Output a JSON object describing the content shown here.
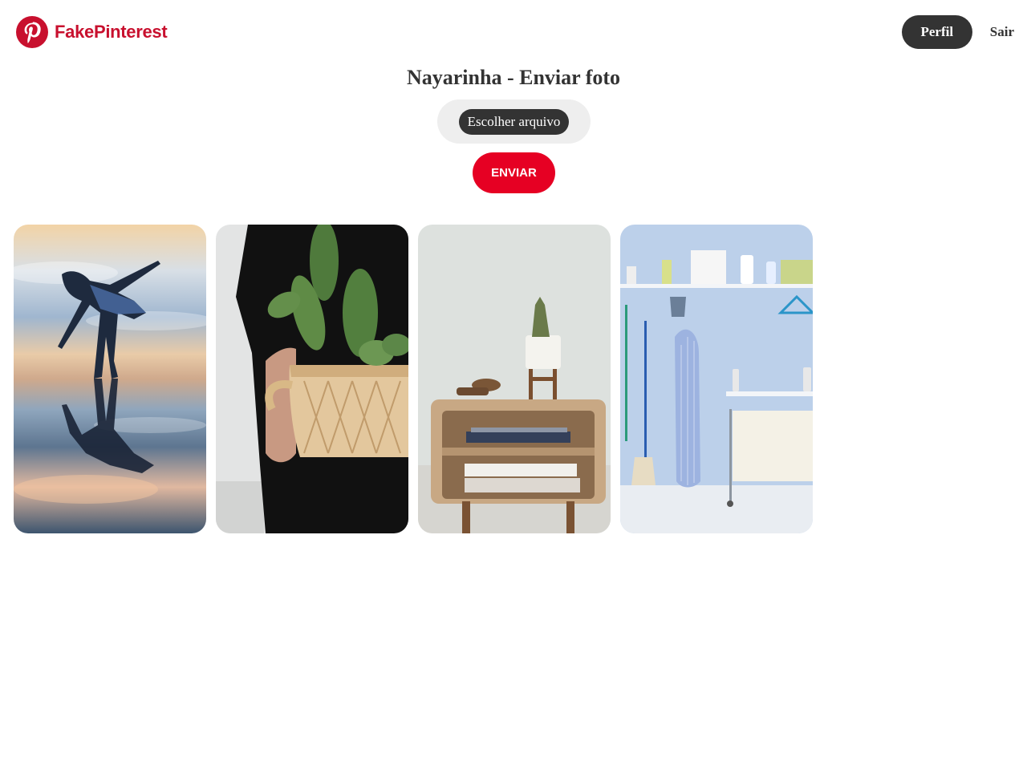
{
  "header": {
    "brand_name": "FakePinterest",
    "brand_color": "#c8102e",
    "logo_icon": "pinterest-logo-icon",
    "nav": {
      "perfil_label": "Perfil",
      "sair_label": "Sair"
    }
  },
  "main": {
    "title": "Nayarinha - Enviar foto",
    "upload": {
      "file_button_label": "Escolher arquivo",
      "submit_label": "ENVIAR",
      "submit_color": "#e60023"
    },
    "photos": [
      {
        "subject": "woman-reflection-photo"
      },
      {
        "subject": "cactus-basket-photo"
      },
      {
        "subject": "nightstand-books-photo"
      },
      {
        "subject": "laundry-room-photo"
      }
    ]
  }
}
